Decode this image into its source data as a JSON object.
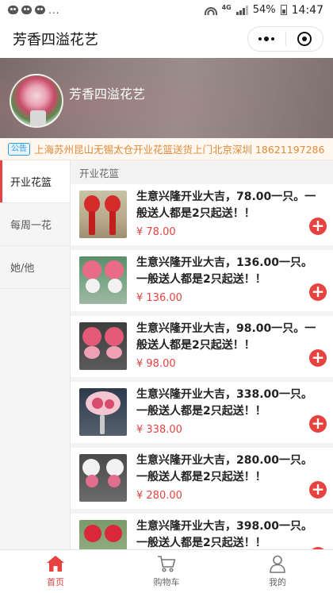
{
  "statusbar": {
    "battery": "54%",
    "time": "14:47",
    "network": "4G",
    "more": "..."
  },
  "app": {
    "title": "芳香四溢花艺"
  },
  "banner": {
    "shop_name": "芳香四溢花艺"
  },
  "notice": {
    "badge": "公告",
    "text": "上海苏州昆山无锡太仓开业花篮送货上门北京深圳 18621197286"
  },
  "categories": [
    {
      "label": "开业花篮",
      "active": true
    },
    {
      "label": "每周一花",
      "active": false
    },
    {
      "label": "她/他",
      "active": false
    }
  ],
  "section_title": "开业花篮",
  "products": [
    {
      "name": "生意兴隆开业大吉，78.00一只。一般送人都是2只起送！！",
      "price": "¥ 78.00"
    },
    {
      "name": "生意兴隆开业大吉，136.00一只。一般送人都是2只起送！！",
      "price": "¥ 136.00"
    },
    {
      "name": "生意兴隆开业大吉，98.00一只。一般送人都是2只起送！！",
      "price": "¥ 98.00"
    },
    {
      "name": "生意兴隆开业大吉，338.00一只。一般送人都是2只起送！！",
      "price": "¥ 338.00"
    },
    {
      "name": "生意兴隆开业大吉，280.00一只。一般送人都是2只起送！！",
      "price": "¥ 280.00"
    },
    {
      "name": "生意兴隆开业大吉，398.00一只。一般送人都是2只起送！！",
      "price": ""
    }
  ],
  "add_symbol": "+",
  "tabs": [
    {
      "label": "首页",
      "icon": "home-icon",
      "active": true
    },
    {
      "label": "购物车",
      "icon": "cart-icon",
      "active": false
    },
    {
      "label": "我的",
      "icon": "user-icon",
      "active": false
    }
  ],
  "colors": {
    "accent": "#e64340",
    "notice_text": "#e08a3a",
    "notice_badge": "#2c9be6"
  }
}
